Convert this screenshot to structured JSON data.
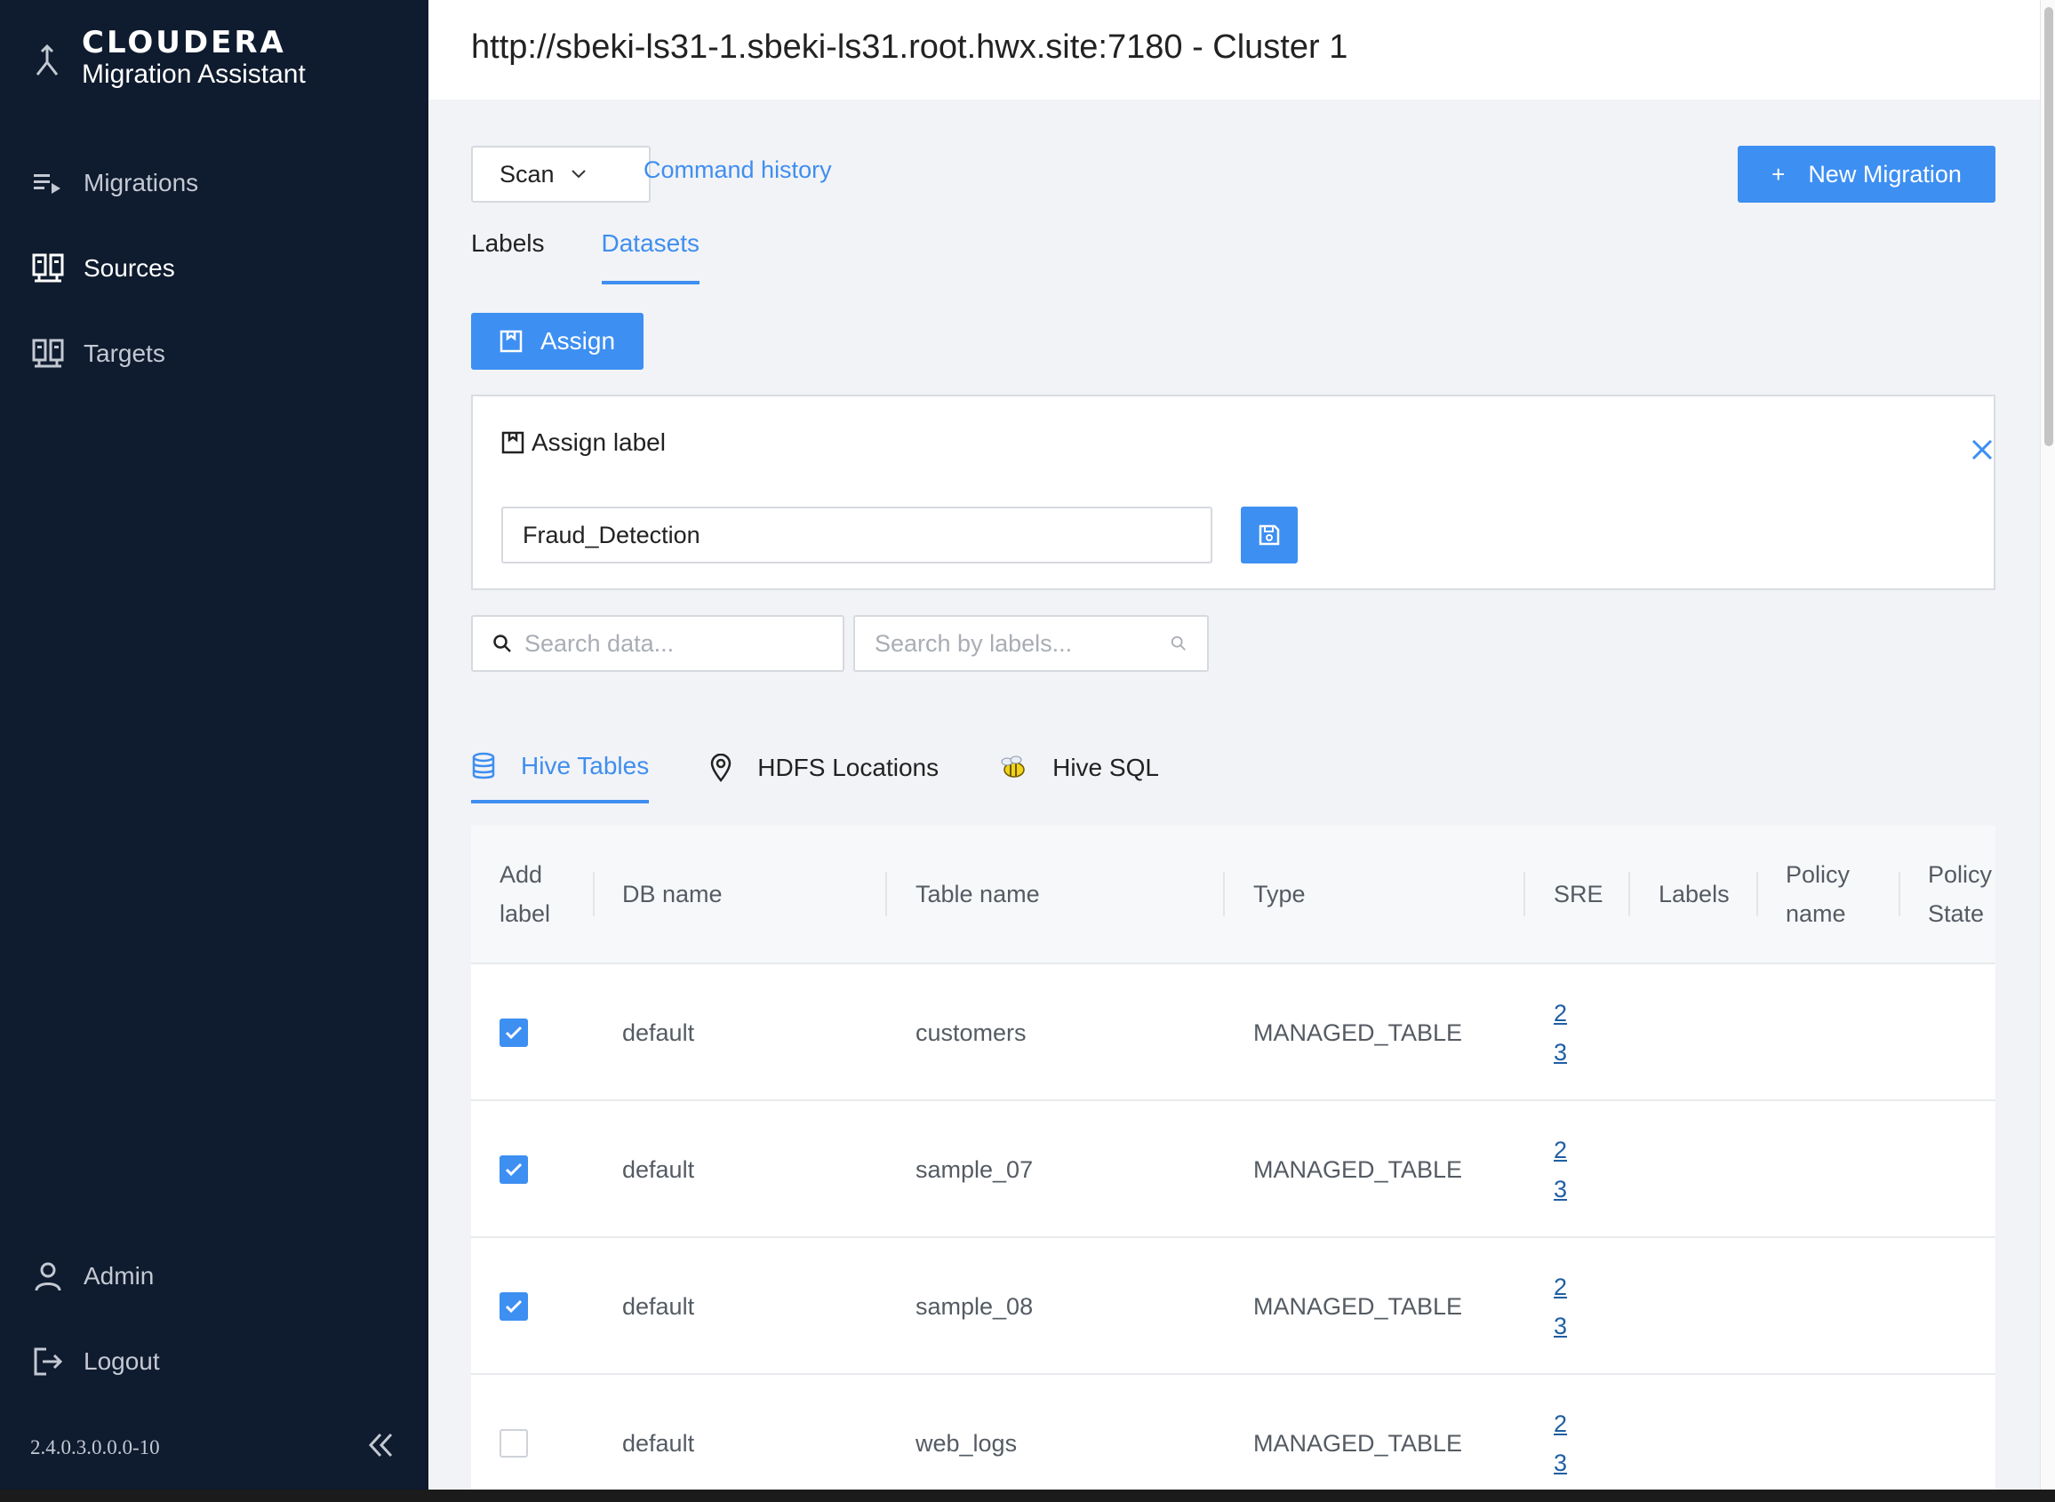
{
  "brand": {
    "logo": "CLOUDERA",
    "subtitle": "Migration Assistant"
  },
  "sidebar": {
    "items": [
      {
        "label": "Migrations",
        "icon": "migrations-list-icon",
        "active": false
      },
      {
        "label": "Sources",
        "icon": "server-icon",
        "active": true
      },
      {
        "label": "Targets",
        "icon": "server-icon",
        "active": false
      }
    ],
    "bottom_items": [
      {
        "label": "Admin",
        "icon": "user-icon"
      },
      {
        "label": "Logout",
        "icon": "logout-icon"
      }
    ],
    "version": "2.4.0.3.0.0.0-10",
    "collapse_icon": "double-chevron-left-icon"
  },
  "header": {
    "title": "http://sbeki-ls31-1.sbeki-ls31.root.hwx.site:7180 - Cluster 1"
  },
  "toolbar": {
    "scan_label": "Scan",
    "command_history_label": "Command history",
    "new_migration_plus": "+",
    "new_migration_label": "New Migration"
  },
  "label_tabs": [
    {
      "label": "Labels",
      "active": false
    },
    {
      "label": "Datasets",
      "active": true
    }
  ],
  "assign": {
    "button_label": "Assign",
    "panel_title": "Assign label",
    "input_value": "Fraud_Detection"
  },
  "search": {
    "data_placeholder": "Search data...",
    "labels_placeholder": "Search by labels..."
  },
  "data_tabs": [
    {
      "label": "Hive Tables",
      "icon": "database-icon",
      "active": true
    },
    {
      "label": "HDFS Locations",
      "icon": "location-pin-icon",
      "active": false
    },
    {
      "label": "Hive SQL",
      "icon": "hive-bee-icon",
      "active": false
    }
  ],
  "table": {
    "headers": {
      "add_label_1": "Add",
      "add_label_2": "label",
      "db_name": "DB name",
      "table_name": "Table name",
      "type": "Type",
      "sre": "SRE",
      "labels": "Labels",
      "policy_name_1": "Policy",
      "policy_name_2": "name",
      "policy_state_1": "Policy",
      "policy_state_2": "State"
    },
    "rows": [
      {
        "checked": true,
        "db": "default",
        "table": "customers",
        "type": "MANAGED_TABLE",
        "sre_a": "2",
        "sre_b": "3"
      },
      {
        "checked": true,
        "db": "default",
        "table": "sample_07",
        "type": "MANAGED_TABLE",
        "sre_a": "2",
        "sre_b": "3"
      },
      {
        "checked": true,
        "db": "default",
        "table": "sample_08",
        "type": "MANAGED_TABLE",
        "sre_a": "2",
        "sre_b": "3"
      },
      {
        "checked": false,
        "db": "default",
        "table": "web_logs",
        "type": "MANAGED_TABLE",
        "sre_a": "2",
        "sre_b": "3"
      }
    ]
  },
  "colors": {
    "sidebar_bg": "#0f1b2e",
    "accent": "#3d8ff2",
    "link": "#3f8ef0",
    "page_bg": "#f2f3f6"
  }
}
